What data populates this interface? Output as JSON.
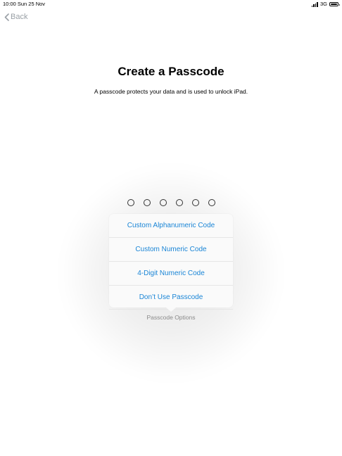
{
  "status_bar": {
    "time_date": "10:00  Sun 25 Nov",
    "network": "3G",
    "signal_icon": "signal-bars-icon",
    "battery_icon": "battery-icon"
  },
  "nav": {
    "back_label": "Back"
  },
  "header": {
    "title": "Create a Passcode",
    "subtitle": "A passcode protects your data and is used to unlock iPad."
  },
  "passcode": {
    "digit_count": 6
  },
  "popover": {
    "items": [
      {
        "label": "Custom Alphanumeric Code"
      },
      {
        "label": "Custom Numeric Code"
      },
      {
        "label": "4-Digit Numeric Code"
      },
      {
        "label": "Don’t Use Passcode"
      }
    ]
  },
  "options_link": "Passcode Options",
  "colors": {
    "accent": "#1a85d6",
    "secondary_text": "#8a8a8a"
  }
}
